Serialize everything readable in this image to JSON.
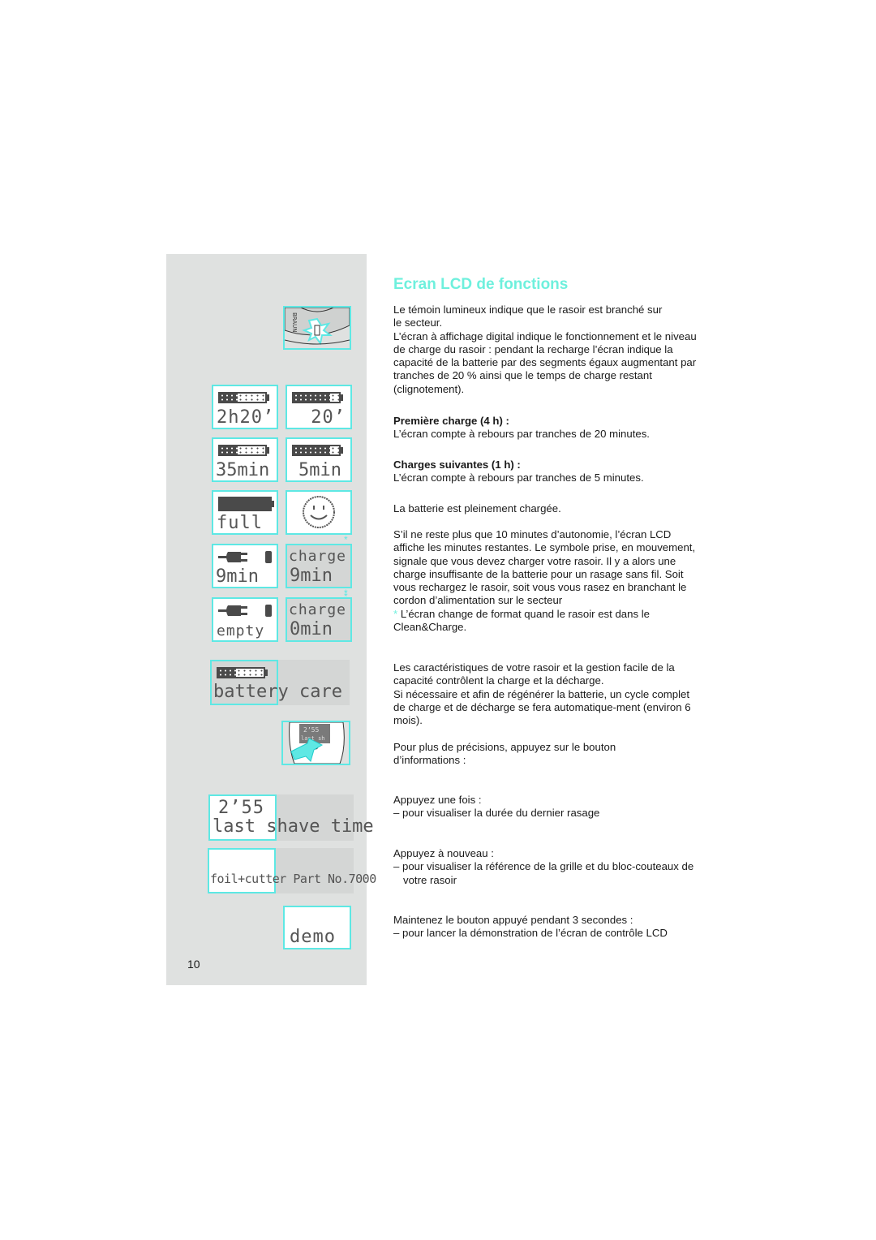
{
  "page_number": "10",
  "title": "Ecran LCD de fonctions",
  "intro": {
    "line1": "Le témoin lumineux indique que le rasoir est branché sur le secteur.",
    "line2": "L’écran à affichage digital indique le fonctionnement et le niveau de charge du rasoir : pendant la recharge l’écran indique la capacité de la batterie par des segments égaux augmentant par tranches de 20 % ainsi que le temps de charge restant (clignotement)."
  },
  "first_charge": {
    "heading": "Première charge (4 h) :",
    "text": "L’écran compte à rebours par tranches de 20 minutes."
  },
  "next_charges": {
    "heading": "Charges suivantes (1 h) :",
    "text": "L’écran compte à rebours par tranches de 5 minutes."
  },
  "full_text": "La batterie est pleinement chargée.",
  "low_battery": {
    "text": "S’il ne reste plus que 10 minutes d’autonomie, l’écran LCD affiche les minutes restantes. Le symbole prise, en mouvement, signale que vous devez charger votre rasoir. Il y a alors une charge insuffisante de la batterie pour un rasage sans fil. Soit vous rechargez le rasoir, soit vous vous rasez en branchant le cordon d’alimentation sur le secteur",
    "star": "*",
    "note": "L’écran change de format quand le rasoir est dans le Clean&Charge."
  },
  "battery_care": {
    "text1": "Les caractéristiques de votre rasoir et la gestion facile de la capacité contrôlent la charge et la décharge.",
    "text2": "Si nécessaire et afin de régénérer la batterie, un cycle complet de charge et de décharge se fera automatique-ment (environ 6 mois)."
  },
  "info_button": "Pour plus de précisions, appuyez sur le bouton d’informations :",
  "press_once": {
    "heading": "Appuyez une fois :",
    "item": "–  pour visualiser la durée du dernier rasage"
  },
  "press_again": {
    "heading": "Appuyez à nouveau :",
    "item": "–  pour visualiser la référence de la grille et du bloc-couteaux de votre rasoir"
  },
  "hold": {
    "heading": "Maintenez le bouton appuyé pendant 3 secondes :",
    "item": "–  pour lancer la démonstration de l’écran de contrôle LCD"
  },
  "lcd": {
    "first_charge_a": {
      "time": "2h20’",
      "battery_fill": 0.4
    },
    "first_charge_b": {
      "time": "20’",
      "battery_fill": 0.8
    },
    "next_charge_a": {
      "time": "35min",
      "battery_fill": 0.4
    },
    "next_charge_b": {
      "time": "5min",
      "battery_fill": 0.8
    },
    "full": {
      "label": "full",
      "battery_fill": 1.0
    },
    "smiley": "☺",
    "low_a": {
      "time": "9min"
    },
    "low_b": {
      "label": "charge",
      "time": "9min"
    },
    "empty_a": {
      "label": "empty"
    },
    "empty_b": {
      "label": "charge",
      "time": "0min"
    },
    "battery_care": {
      "label": "battery care",
      "battery_fill": 0.4
    },
    "last_shave": {
      "time": "2’55",
      "label": "last shave time"
    },
    "part": {
      "label": "foil+cutter Part No.7000"
    },
    "demo": {
      "label": "demo"
    },
    "star": "*"
  },
  "illustrations": {
    "shaver_brand": "BRAUN",
    "shaver_screen": {
      "time": "2’55",
      "label": "last sh"
    }
  },
  "colors": {
    "accent": "#5ee8e4",
    "title": "#6ef0dd",
    "panel": "#dfe1e0",
    "lcd_dim": "#d4d6d5",
    "lcd_ink": "#4a4a4a"
  }
}
